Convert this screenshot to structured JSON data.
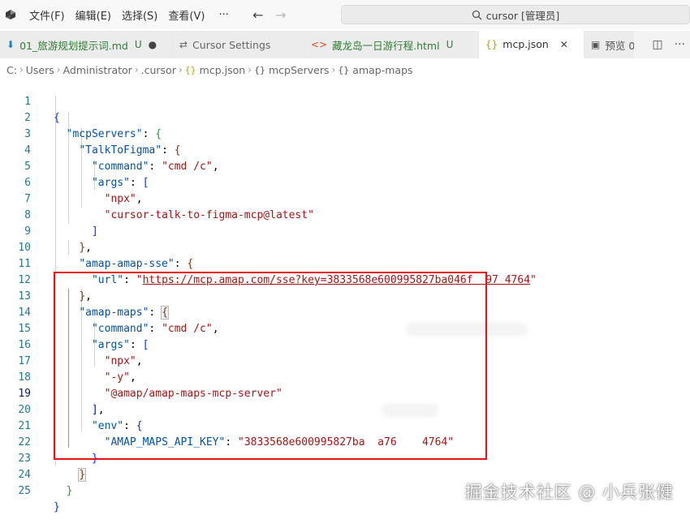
{
  "menu": {
    "items": [
      "文件(F)",
      "编辑(E)",
      "选择(S)",
      "查看(V)"
    ],
    "more": "···"
  },
  "command_center": {
    "text": "cursor [管理员]"
  },
  "tabs": [
    {
      "label": "01_旅游规划提示词.md",
      "badge": "U",
      "mark": "●",
      "color": "#2e7d32"
    },
    {
      "label": "Cursor Settings",
      "badge": "",
      "mark": "",
      "color": "#666666"
    },
    {
      "label": "藏龙岛一日游行程.html",
      "badge": "U",
      "mark": "",
      "color": "#2e7d32"
    },
    {
      "label": "mcp.json",
      "badge": "",
      "mark": "✕",
      "color": "#333333"
    },
    {
      "label": "预览 0",
      "badge": "",
      "mark": "",
      "color": "#555555"
    }
  ],
  "breadcrumb": [
    "C:",
    "Users",
    "Administrator",
    ".cursor",
    "mcp.json",
    "mcpServers",
    "amap-maps"
  ],
  "editor": {
    "line_numbers": [
      "1",
      "2",
      "3",
      "4",
      "5",
      "6",
      "7",
      "8",
      "9",
      "10",
      "11",
      "12",
      "13",
      "14",
      "15",
      "16",
      "17",
      "18",
      "19",
      "20",
      "21",
      "22",
      "23",
      "24",
      "25"
    ],
    "keys": {
      "mcpServers": "\"mcpServers\"",
      "talk": "\"TalkToFigma\"",
      "command": "\"command\"",
      "args": "\"args\"",
      "sse": "\"amap-amap-sse\"",
      "url": "\"url\"",
      "maps": "\"amap-maps\"",
      "env": "\"env\"",
      "api_key": "\"AMAP_MAPS_API_KEY\""
    },
    "strings": {
      "cmd": "\"cmd /c\"",
      "npx": "\"npx\"",
      "figma_pkg": "\"cursor-talk-to-figma-mcp@latest\"",
      "url_value": "https://mcp.amap.com/sse?key=3833568e600995827ba046f  97 4764",
      "url_quote": "\"",
      "y_flag": "\"-y\"",
      "amap_pkg": "\"@amap/amap-maps-mcp-server\"",
      "api_value": "\"3833568e600995827ba  a76    4764\""
    }
  },
  "watermark": "掘金技术社区 @ 小兵张健"
}
